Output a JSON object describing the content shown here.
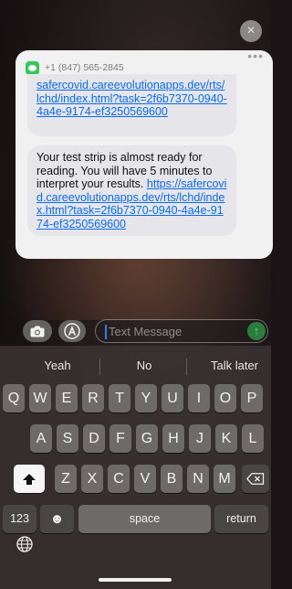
{
  "notification": {
    "sender": "+1 (847) 565-2845",
    "more_label": "•••",
    "close_label": "×",
    "message1": {
      "link": "safercovid.careevolutionapps.dev/rts/lchd/index.html?task=2f6b7370-0940-4a4e-9174-ef3250569600"
    },
    "message2": {
      "text": "Your test strip is almost ready for reading.  You will have 5 minutes to interpret your results. ",
      "link": "https://safercovid.careevolutionapps.dev/rts/lchd/index.html?task=2f6b7370-0940-4a4e-9174-ef3250569600"
    }
  },
  "compose": {
    "placeholder": "Text Message",
    "send_icon": "arrow-up-icon"
  },
  "suggestions": [
    "Yeah",
    "No",
    "Talk later"
  ],
  "keyboard": {
    "row1": [
      "Q",
      "W",
      "E",
      "R",
      "T",
      "Y",
      "U",
      "I",
      "O",
      "P"
    ],
    "row2": [
      "A",
      "S",
      "D",
      "F",
      "G",
      "H",
      "J",
      "K",
      "L"
    ],
    "row3": [
      "Z",
      "X",
      "C",
      "V",
      "B",
      "N",
      "M"
    ],
    "numbers_label": "123",
    "emoji_label": "☻",
    "space_label": "space",
    "return_label": "return",
    "shift_icon": "shift-icon",
    "delete_icon": "delete-icon",
    "globe_icon": "globe-icon"
  }
}
